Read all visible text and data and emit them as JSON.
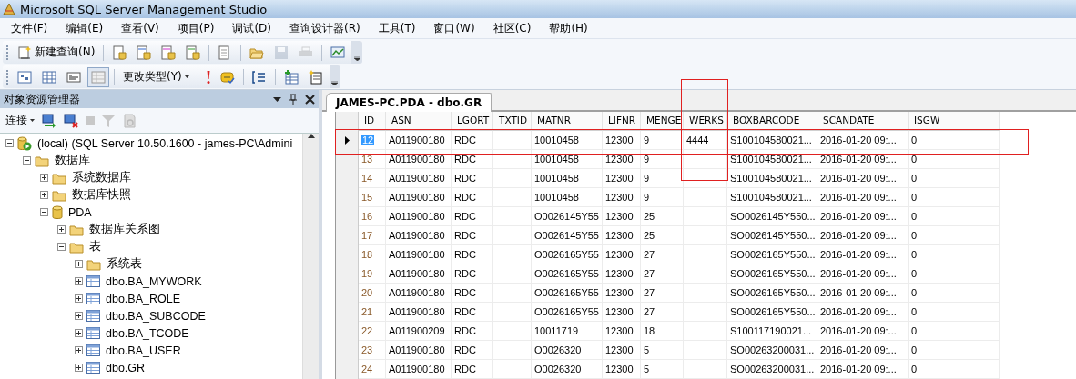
{
  "window": {
    "title": "Microsoft SQL Server Management Studio"
  },
  "menu": [
    "文件(F)",
    "编辑(E)",
    "查看(V)",
    "项目(P)",
    "调试(D)",
    "查询设计器(R)",
    "工具(T)",
    "窗口(W)",
    "社区(C)",
    "帮助(H)"
  ],
  "toolbar1": {
    "new_query": "新建查询(N)",
    "buttons": [
      {
        "disabled": false
      },
      {
        "disabled": false
      },
      {
        "disabled": false
      },
      {
        "disabled": false
      },
      {
        "disabled": false
      },
      {
        "disabled": false
      },
      {
        "disabled": true
      },
      {
        "disabled": true
      },
      {
        "disabled": false
      }
    ]
  },
  "toolbar2": {
    "panes": [
      {
        "selected": false
      },
      {
        "selected": false
      },
      {
        "selected": false
      },
      {
        "selected": true
      }
    ],
    "change_type": "更改类型(Y)"
  },
  "object_explorer": {
    "title": "对象资源管理器",
    "connect": "连接",
    "tree": [
      {
        "label": "(local) (SQL Server 10.50.1600 - james-PC\\Admini",
        "kind": "server",
        "expanded": true,
        "children": [
          {
            "label": "数据库",
            "kind": "folder",
            "expanded": true,
            "children": [
              {
                "label": "系统数据库",
                "kind": "folder",
                "expanded": false
              },
              {
                "label": "数据库快照",
                "kind": "folder",
                "expanded": false
              },
              {
                "label": "PDA",
                "kind": "database",
                "expanded": true,
                "children": [
                  {
                    "label": "数据库关系图",
                    "kind": "folder",
                    "expanded": false
                  },
                  {
                    "label": "表",
                    "kind": "folder",
                    "expanded": true,
                    "children": [
                      {
                        "label": "系统表",
                        "kind": "folder",
                        "expanded": false
                      },
                      {
                        "label": "dbo.BA_MYWORK",
                        "kind": "table",
                        "expanded": false
                      },
                      {
                        "label": "dbo.BA_ROLE",
                        "kind": "table",
                        "expanded": false
                      },
                      {
                        "label": "dbo.BA_SUBCODE",
                        "kind": "table",
                        "expanded": false
                      },
                      {
                        "label": "dbo.BA_TCODE",
                        "kind": "table",
                        "expanded": false
                      },
                      {
                        "label": "dbo.BA_USER",
                        "kind": "table",
                        "expanded": false
                      },
                      {
                        "label": "dbo.GR",
                        "kind": "table",
                        "expanded": false
                      }
                    ]
                  }
                ]
              }
            ]
          }
        ]
      }
    ]
  },
  "document_tabs": [
    {
      "label": "JAMES-PC.PDA - dbo.GR",
      "selected": true
    }
  ],
  "table": {
    "columns": [
      {
        "label": "ID",
        "marked": false
      },
      {
        "label": "ASN",
        "marked": false
      },
      {
        "label": "LGORT",
        "marked": false
      },
      {
        "label": "TXTID",
        "marked": false
      },
      {
        "label": "MATNR",
        "marked": false
      },
      {
        "label": "LIFNR",
        "marked": false
      },
      {
        "label": "MENGE",
        "marked": false
      },
      {
        "label": "WERKS",
        "marked": true
      },
      {
        "label": "BOXBARCODE",
        "marked": false
      },
      {
        "label": "SCANDATE",
        "marked": false
      },
      {
        "label": "ISGW",
        "marked": false
      }
    ],
    "rows": [
      {
        "selected": true,
        "marked": true,
        "cells": [
          "12",
          "A011900180",
          "RDC",
          null,
          "10010458",
          "12300",
          "9",
          "4444",
          "S100104580021...",
          "2016-01-20 09:...",
          "0"
        ]
      },
      {
        "selected": false,
        "cells": [
          "13",
          "A011900180",
          "RDC",
          null,
          "10010458",
          "12300",
          "9",
          null,
          "S100104580021...",
          "2016-01-20 09:...",
          "0"
        ]
      },
      {
        "selected": false,
        "cells": [
          "14",
          "A011900180",
          "RDC",
          null,
          "10010458",
          "12300",
          "9",
          null,
          "S100104580021...",
          "2016-01-20 09:...",
          "0"
        ]
      },
      {
        "selected": false,
        "cells": [
          "15",
          "A011900180",
          "RDC",
          null,
          "10010458",
          "12300",
          "9",
          null,
          "S100104580021...",
          "2016-01-20 09:...",
          "0"
        ]
      },
      {
        "selected": false,
        "cells": [
          "16",
          "A011900180",
          "RDC",
          null,
          "O0026145Y55",
          "12300",
          "25",
          null,
          "SO0026145Y550...",
          "2016-01-20 09:...",
          "0"
        ]
      },
      {
        "selected": false,
        "cells": [
          "17",
          "A011900180",
          "RDC",
          null,
          "O0026145Y55",
          "12300",
          "25",
          null,
          "SO0026145Y550...",
          "2016-01-20 09:...",
          "0"
        ]
      },
      {
        "selected": false,
        "cells": [
          "18",
          "A011900180",
          "RDC",
          null,
          "O0026165Y55",
          "12300",
          "27",
          null,
          "SO0026165Y550...",
          "2016-01-20 09:...",
          "0"
        ]
      },
      {
        "selected": false,
        "cells": [
          "19",
          "A011900180",
          "RDC",
          null,
          "O0026165Y55",
          "12300",
          "27",
          null,
          "SO0026165Y550...",
          "2016-01-20 09:...",
          "0"
        ]
      },
      {
        "selected": false,
        "cells": [
          "20",
          "A011900180",
          "RDC",
          null,
          "O0026165Y55",
          "12300",
          "27",
          null,
          "SO0026165Y550...",
          "2016-01-20 09:...",
          "0"
        ]
      },
      {
        "selected": false,
        "cells": [
          "21",
          "A011900180",
          "RDC",
          null,
          "O0026165Y55",
          "12300",
          "27",
          null,
          "SO0026165Y550...",
          "2016-01-20 09:...",
          "0"
        ]
      },
      {
        "selected": false,
        "cells": [
          "22",
          "A011900209",
          "RDC",
          null,
          "10011719",
          "12300",
          "18",
          null,
          "S100117190021...",
          "2016-01-20 09:...",
          "0"
        ]
      },
      {
        "selected": false,
        "cells": [
          "23",
          "A011900180",
          "RDC",
          null,
          "O0026320",
          "12300",
          "5",
          null,
          "SO00263200031...",
          "2016-01-20 09:...",
          "0"
        ]
      },
      {
        "selected": false,
        "cells": [
          "24",
          "A011900180",
          "RDC",
          null,
          "O0026320",
          "12300",
          "5",
          null,
          "SO00263200031...",
          "2016-01-20 09:...",
          "0"
        ]
      }
    ]
  }
}
